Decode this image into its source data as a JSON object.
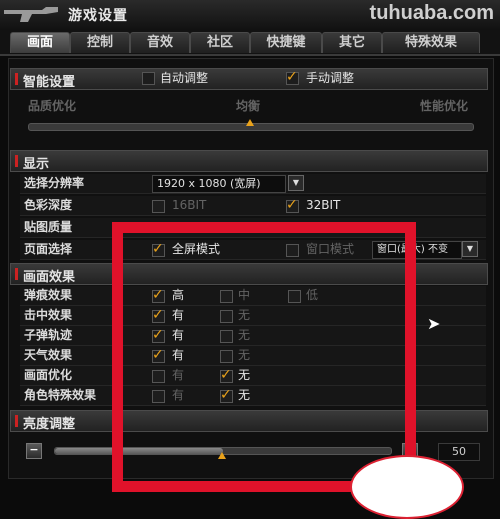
{
  "window": {
    "title": "游戏设置",
    "watermark": "tuhuaba.com"
  },
  "tabs": [
    {
      "label": "画面",
      "active": true
    },
    {
      "label": "控制"
    },
    {
      "label": "音效"
    },
    {
      "label": "社区"
    },
    {
      "label": "快捷键"
    },
    {
      "label": "其它"
    },
    {
      "label": "特殊效果"
    }
  ],
  "smart": {
    "label": "智能设置",
    "auto_label": "自动调整",
    "manual_label": "手动调整",
    "auto_checked": false,
    "manual_checked": true,
    "slider_left": "品质优化",
    "slider_mid": "均衡",
    "slider_right": "性能优化",
    "slider_value": 0.5
  },
  "display": {
    "section": "显示",
    "resolution_label": "选择分辨率",
    "resolution_value": "1920 x 1080 (宽屏)",
    "color_label": "色彩深度",
    "color_16": "16BIT",
    "color_32": "32BIT",
    "texture_label": "贴图质量",
    "window_label": "页面选择",
    "fullscreen": "全屏模式",
    "windowed": "窗口模式",
    "window_size": "窗口(最大) 不变"
  },
  "effects": {
    "section": "画面效果",
    "rows": [
      {
        "label": "弹痕效果",
        "opts": [
          "高",
          "中",
          "低"
        ],
        "checked": [
          true,
          false,
          false
        ]
      },
      {
        "label": "击中效果",
        "opts": [
          "有",
          "无"
        ],
        "checked": [
          true,
          false
        ]
      },
      {
        "label": "子弹轨迹",
        "opts": [
          "有",
          "无"
        ],
        "checked": [
          true,
          false
        ]
      },
      {
        "label": "天气效果",
        "opts": [
          "有",
          "无"
        ],
        "checked": [
          true,
          false
        ]
      },
      {
        "label": "画面优化",
        "opts": [
          "有",
          "无"
        ],
        "checked": [
          false,
          true
        ]
      },
      {
        "label": "角色特殊效果",
        "opts": [
          "有",
          "无"
        ],
        "checked": [
          false,
          true
        ]
      }
    ]
  },
  "brightness": {
    "section": "亮度调整",
    "value": "50",
    "level": 0.5
  },
  "colors": {
    "accent": "#e9a21b",
    "highlight_box": "#e0122a"
  }
}
